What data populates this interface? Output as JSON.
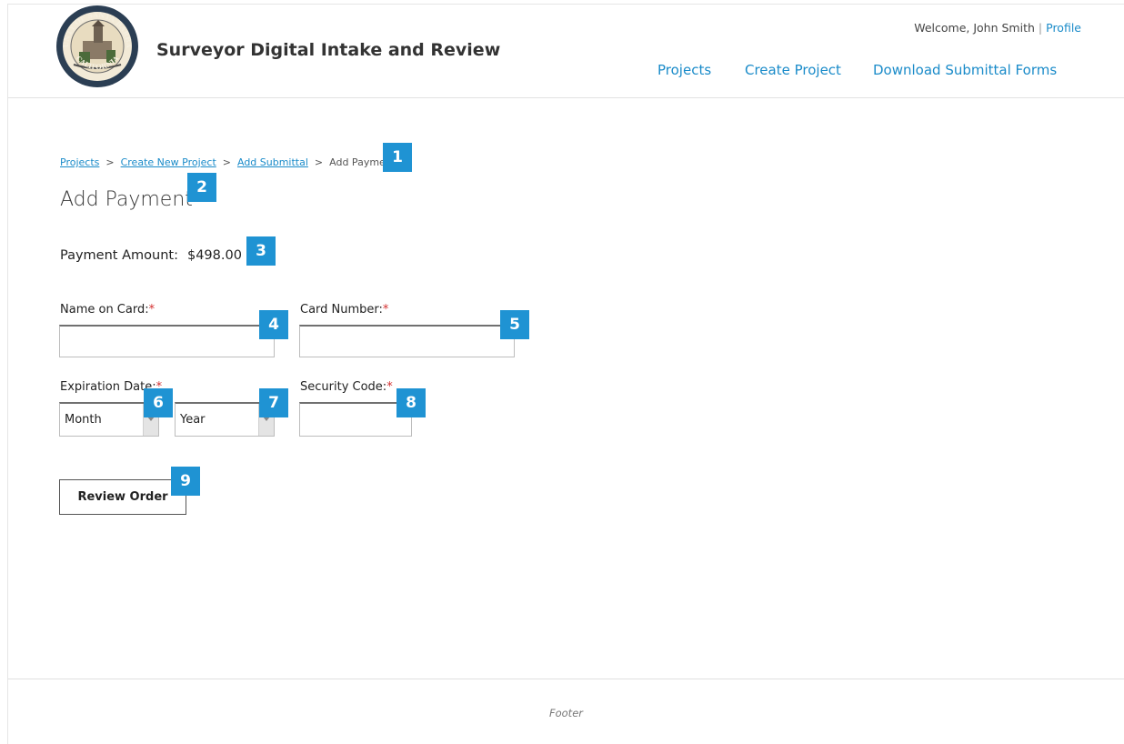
{
  "header": {
    "app_title": "Surveyor Digital Intake and Review",
    "welcome_text": "Welcome, John Smith",
    "separator": "|",
    "profile_link": "Profile",
    "seal_text": [
      "COUNTY OF SANTA BARBARA",
      "CALIFORNIA"
    ],
    "nav": [
      {
        "label": "Projects"
      },
      {
        "label": "Create Project"
      },
      {
        "label": "Download Submittal Forms"
      }
    ]
  },
  "breadcrumb": {
    "items": [
      "Projects",
      "Create New Project",
      "Add Submittal",
      "Add Payment"
    ],
    "separator": ">"
  },
  "page_title": "Add Payment",
  "payment": {
    "amount_label": "Payment Amount:",
    "amount_value": "$498.00"
  },
  "form": {
    "name_label": "Name on Card:",
    "card_number_label": "Card Number:",
    "expiration_label": "Expiration Date:",
    "security_code_label": "Security Code:",
    "required_marker": "*",
    "name_value": "",
    "card_number_value": "",
    "security_code_value": "",
    "month_selected": "Month",
    "year_selected": "Year",
    "submit_label": "Review Order"
  },
  "badges": [
    "1",
    "2",
    "3",
    "4",
    "5",
    "6",
    "7",
    "8",
    "9"
  ],
  "footer": {
    "text": "Footer"
  },
  "colors": {
    "link": "#1a8bc9",
    "badge": "#1f93d3",
    "required": "#d32f2f"
  }
}
